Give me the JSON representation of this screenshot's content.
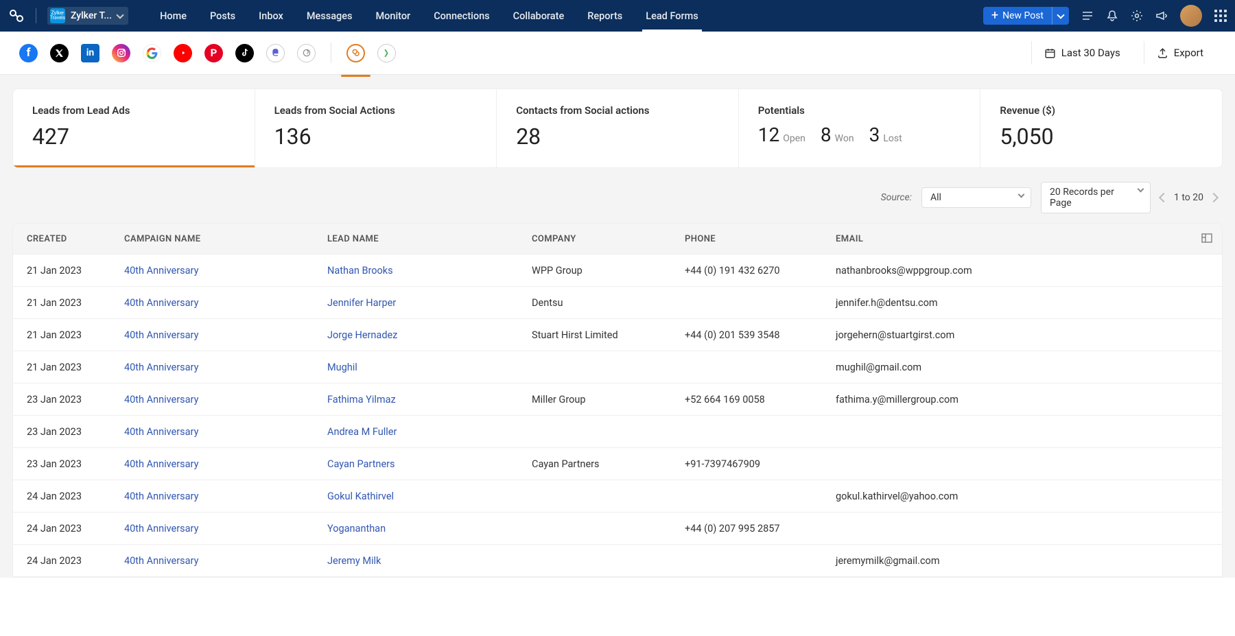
{
  "header": {
    "brand": "Zylker T...",
    "nav": [
      "Home",
      "Posts",
      "Inbox",
      "Messages",
      "Monitor",
      "Connections",
      "Collaborate",
      "Reports",
      "Lead Forms"
    ],
    "active_nav": 8,
    "new_post": "New Post"
  },
  "social": {
    "date_range": "Last 30 Days",
    "export": "Export"
  },
  "stats": [
    {
      "title": "Leads from Lead Ads",
      "value": "427",
      "active": true
    },
    {
      "title": "Leads from Social Actions",
      "value": "136"
    },
    {
      "title": "Contacts from Social actions",
      "value": "28"
    },
    {
      "title": "Potentials",
      "potentials": [
        {
          "n": "12",
          "l": "Open"
        },
        {
          "n": "8",
          "l": "Won"
        },
        {
          "n": "3",
          "l": "Lost"
        }
      ]
    },
    {
      "title": "Revenue ($)",
      "value": "5,050"
    }
  ],
  "filters": {
    "source_label": "Source:",
    "source_value": "All",
    "records": "20 Records per Page",
    "range": "1 to 20"
  },
  "table": {
    "headers": [
      "CREATED",
      "CAMPAIGN NAME",
      "LEAD NAME",
      "COMPANY",
      "PHONE",
      "EMAIL"
    ],
    "rows": [
      {
        "created": "21 Jan 2023",
        "campaign": "40th Anniversary",
        "lead": "Nathan Brooks",
        "company": "WPP Group",
        "phone": "+44 (0) 191 432 6270",
        "email": "nathanbrooks@wppgroup.com"
      },
      {
        "created": "21 Jan 2023",
        "campaign": "40th Anniversary",
        "lead": "Jennifer Harper",
        "company": "Dentsu",
        "phone": "",
        "email": "jennifer.h@dentsu.com"
      },
      {
        "created": "21 Jan 2023",
        "campaign": "40th Anniversary",
        "lead": "Jorge Hernadez",
        "company": "Stuart Hirst Limited",
        "phone": "+44 (0) 201 539 3548",
        "email": "jorgehern@stuartgirst.com"
      },
      {
        "created": "21 Jan 2023",
        "campaign": "40th Anniversary",
        "lead": "Mughil",
        "company": "",
        "phone": "",
        "email": "mughil@gmail.com"
      },
      {
        "created": "23 Jan 2023",
        "campaign": "40th Anniversary",
        "lead": "Fathima Yilmaz",
        "company": "Miller Group",
        "phone": "+52 664 169 0058",
        "email": "fathima.y@millergroup.com"
      },
      {
        "created": "23 Jan 2023",
        "campaign": "40th Anniversary",
        "lead": "Andrea M Fuller",
        "company": "",
        "phone": "",
        "email": ""
      },
      {
        "created": "23 Jan 2023",
        "campaign": "40th Anniversary",
        "lead": "Cayan Partners",
        "company": "Cayan Partners",
        "phone": "+91-7397467909",
        "email": ""
      },
      {
        "created": "24 Jan 2023",
        "campaign": "40th Anniversary",
        "lead": "Gokul Kathirvel",
        "company": "",
        "phone": "",
        "email": "gokul.kathirvel@yahoo.com"
      },
      {
        "created": "24 Jan 2023",
        "campaign": "40th Anniversary",
        "lead": "Yogananthan",
        "company": "",
        "phone": "+44 (0) 207 995 2857",
        "email": ""
      },
      {
        "created": "24 Jan 2023",
        "campaign": "40th Anniversary",
        "lead": "Jeremy Milk",
        "company": "",
        "phone": "",
        "email": "jeremymilk@gmail.com"
      }
    ]
  }
}
